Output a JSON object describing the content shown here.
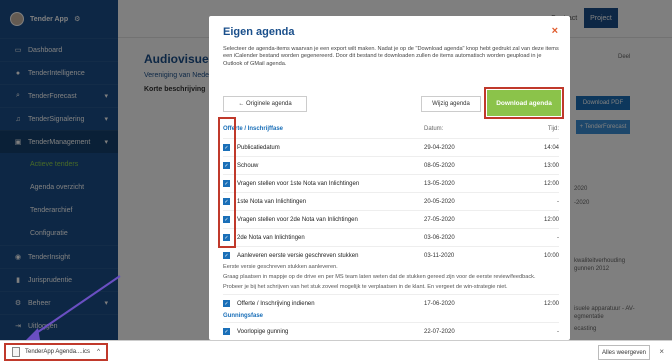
{
  "sidebar": {
    "app_title": "Tender App",
    "items": [
      {
        "label": "Dashboard",
        "icon": "monitor-icon"
      },
      {
        "label": "TenderIntelligence",
        "icon": "lightbulb-icon"
      },
      {
        "label": "TenderForecast",
        "icon": "search-icon"
      },
      {
        "label": "TenderSignalering",
        "icon": "bell-icon"
      },
      {
        "label": "TenderManagement",
        "icon": "briefcase-icon"
      }
    ],
    "sub_items": [
      {
        "label": "Actieve tenders"
      },
      {
        "label": "Agenda overzicht"
      },
      {
        "label": "Tenderarchief"
      },
      {
        "label": "Configuratie"
      }
    ],
    "lower_items": [
      {
        "label": "TenderInsight",
        "icon": "eye-icon"
      },
      {
        "label": "Jurisprudentie",
        "icon": "gavel-icon"
      },
      {
        "label": "Beheer",
        "icon": "gear-icon"
      },
      {
        "label": "Uitloggen",
        "icon": "logout-icon"
      }
    ]
  },
  "background": {
    "title": "Audiovisuele r",
    "subtitle": "Vereniging van Nede",
    "section": "Korte beschrijving",
    "top_buttons": [
      "Contract",
      "Project"
    ],
    "right_buttons": [
      "Download PDF",
      "+ TenderForecast"
    ],
    "deel": "Deel",
    "date_right": "2020",
    "date_right_2": "-2020",
    "right_note_1": "kwaliteitverhouding",
    "right_note_2": "gunnen 2012",
    "right_note_3": "isuele apparatuur - AV-",
    "right_note_4": "egmentatie",
    "right_note_5": "ecasting"
  },
  "modal": {
    "title": "Eigen agenda",
    "close": "×",
    "description": "Selecteer de agenda-items waarvan je een export wilt maken. Nadat je op de \"Download agenda\" knop hebt gedrukt zal van deze items een iCalender bestand worden gegenereerd. Door dit bestand te downloaden zullen de items automatisch worden geupload in je Outlook of GMail agenda.",
    "back_button": "← Originele agenda",
    "edit_button": "Wijzig agenda",
    "download_button": "Download agenda",
    "col_section": "Offerte / Inschrijffase",
    "col_date": "Datum:",
    "col_time": "Tijd:",
    "rows": [
      {
        "label": "Publicatiedatum",
        "date": "29-04-2020",
        "time": "14:04"
      },
      {
        "label": "Schouw",
        "date": "08-05-2020",
        "time": "13:00"
      },
      {
        "label": "Vragen stellen voor 1ste Nota van Inlichtingen",
        "date": "13-05-2020",
        "time": "12:00"
      },
      {
        "label": "1ste Nota van Inlichtingen",
        "date": "20-05-2020",
        "time": "-"
      },
      {
        "label": "Vragen stellen voor 2de Nota van Inlichtingen",
        "date": "27-05-2020",
        "time": "12:00"
      },
      {
        "label": "2de Nota van Inlichtingen",
        "date": "03-06-2020",
        "time": "-"
      },
      {
        "label": "Aanleveren eerste versie geschreven stukken",
        "date": "03-11-2020",
        "time": "10:00"
      }
    ],
    "note_1": "Eerste versie geschreven stukken aanleveren.",
    "note_2": "Graag plaatsen in mappje op de drive en per MS team laten weten dat de stukken gereed zijn voor de eerste review/feedback.",
    "note_3": "Probeer je bij het schrijven van het stuk zoveel mogelijk te verplaatsen in de klant. En vergeet de win-strategie niet.",
    "row_extra": {
      "label": "Offerte / Inschrijving indienen",
      "date": "17-06-2020",
      "time": "12:00"
    },
    "section_2": "Gunningsfase",
    "row_extra_2": {
      "label": "Voorlopige gunning",
      "date": "22-07-2020",
      "time": "-"
    }
  },
  "download_bar": {
    "file_name": "TenderApp Agenda....ics",
    "show_all": "Alles weergeven",
    "close": "×"
  }
}
